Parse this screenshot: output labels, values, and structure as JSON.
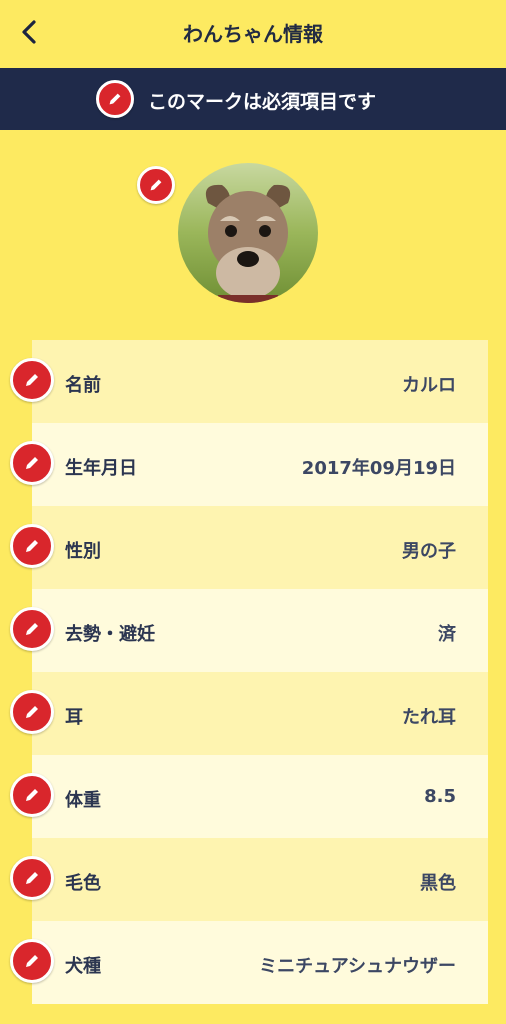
{
  "nav": {
    "title": "わんちゃん情報",
    "back_icon": "chevron-left-icon"
  },
  "banner": {
    "text": "このマークは必須項目です",
    "icon": "pencil-icon"
  },
  "colors": {
    "background": "#fdea61",
    "banner": "#1f2a4a",
    "required_red": "#d9262c",
    "row_odd": "#fef4b0",
    "row_even": "#fffbdc"
  },
  "avatar": {
    "alt": "dog-photo"
  },
  "fields": [
    {
      "label": "名前",
      "value": "カルロ"
    },
    {
      "label": "生年月日",
      "value": "2017年09月19日"
    },
    {
      "label": "性別",
      "value": "男の子"
    },
    {
      "label": "去勢・避妊",
      "value": "済"
    },
    {
      "label": "耳",
      "value": "たれ耳"
    },
    {
      "label": "体重",
      "value": "8.5"
    },
    {
      "label": "毛色",
      "value": "黒色"
    },
    {
      "label": "犬種",
      "value": "ミニチュアシュナウザー"
    }
  ]
}
